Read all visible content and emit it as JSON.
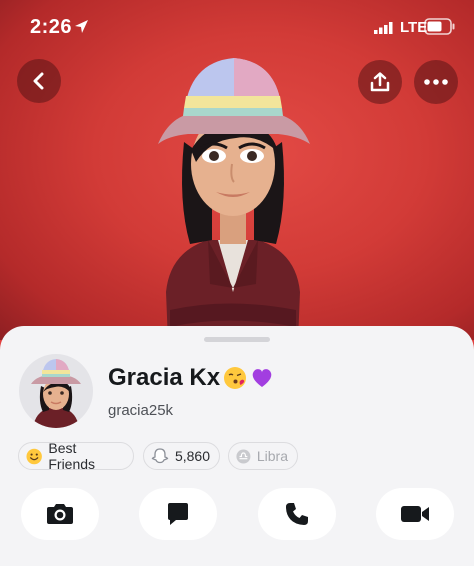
{
  "status_bar": {
    "time": "2:26",
    "network": "LTE"
  },
  "header": {
    "icons": [
      "back-chevron-icon",
      "share-icon",
      "more-dots-icon"
    ]
  },
  "profile": {
    "display_name": "Gracia Kx",
    "name_emojis": [
      "kissing-face-emoji",
      "purple-heart-emoji"
    ],
    "username": "gracia25k",
    "badges": [
      {
        "label": "Best Friends",
        "icon": "smile-emoji-icon"
      },
      {
        "label": "5,860",
        "icon": "snap-score-ghost-icon"
      },
      {
        "label": "Libra",
        "icon": "zodiac-libra-icon"
      }
    ]
  },
  "actions": [
    "camera-icon",
    "chat-icon",
    "phone-icon",
    "video-icon"
  ],
  "colors": {
    "hero_red": "#d23b37",
    "sheet_bg": "#f4f4f6",
    "text_dark": "#16191c"
  }
}
